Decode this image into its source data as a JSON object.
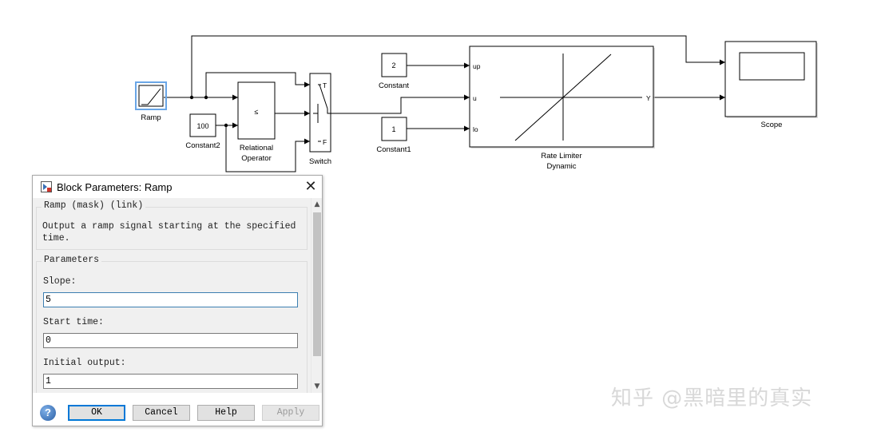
{
  "colors": {
    "line": "#000000",
    "block_selected": "#6aa6e6",
    "dialog_focus": "#3c7fb1",
    "default_button": "#0078d7",
    "watermark": "#d8d8d8"
  },
  "blocks": {
    "ramp": {
      "label": "Ramp"
    },
    "constant2": {
      "label": "Constant2",
      "value": "100"
    },
    "relational_operator": {
      "label_line1": "Relational",
      "label_line2": "Operator",
      "symbol": "≤"
    },
    "switch": {
      "label": "Switch",
      "port_t": "T",
      "port_f": "F"
    },
    "constant": {
      "label": "Constant",
      "value": "2"
    },
    "constant1": {
      "label": "Constant1",
      "value": "1"
    },
    "rate_limiter": {
      "label_line1": "Rate Limiter",
      "label_line2": "Dynamic",
      "port_up": "up",
      "port_u": "u",
      "port_lo": "lo",
      "port_y": "Y"
    },
    "scope": {
      "label": "Scope"
    }
  },
  "dialog": {
    "title": "Block Parameters: Ramp",
    "title_icon": "simulink-block-icon",
    "close_glyph": "✕",
    "mask_group_title": "Ramp (mask) (link)",
    "description_line1": "Output a ramp signal starting at the specified",
    "description_line2": "time.",
    "params_group_title": "Parameters",
    "fields": [
      {
        "label": "Slope:",
        "value": "5"
      },
      {
        "label": "Start time:",
        "value": "0"
      },
      {
        "label": "Initial output:",
        "value": "1"
      }
    ],
    "buttons": {
      "ok": "OK",
      "cancel": "Cancel",
      "help": "Help",
      "apply": "Apply"
    },
    "help_glyph": "?",
    "scroll_up_glyph": "▲",
    "scroll_down_glyph": "▼"
  },
  "watermark": "知乎 @黑暗里的真实"
}
